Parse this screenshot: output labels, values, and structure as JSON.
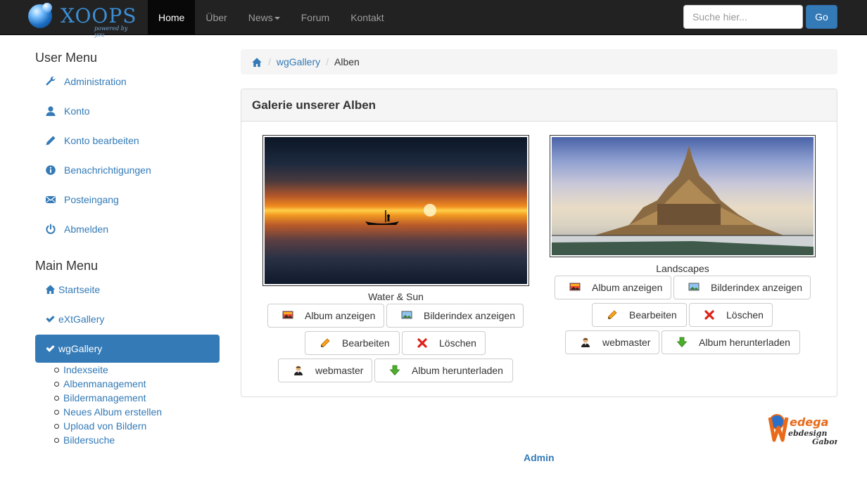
{
  "brand": {
    "name": "XOOPS",
    "tagline": "powered by you"
  },
  "nav": {
    "items": [
      {
        "label": "Home",
        "active": true
      },
      {
        "label": "Über"
      },
      {
        "label": "News",
        "dropdown": true
      },
      {
        "label": "Forum"
      },
      {
        "label": "Kontakt"
      }
    ],
    "search_placeholder": "Suche hier...",
    "search_button": "Go"
  },
  "user_menu": {
    "heading": "User Menu",
    "items": [
      {
        "label": "Administration",
        "icon": "wrench-icon"
      },
      {
        "label": "Konto",
        "icon": "user-icon"
      },
      {
        "label": "Konto bearbeiten",
        "icon": "pencil-icon"
      },
      {
        "label": "Benachrichtigungen",
        "icon": "info-icon"
      },
      {
        "label": "Posteingang",
        "icon": "envelope-icon"
      },
      {
        "label": "Abmelden",
        "icon": "power-icon"
      }
    ]
  },
  "main_menu": {
    "heading": "Main Menu",
    "items": [
      {
        "label": "Startseite",
        "icon": "home-icon"
      },
      {
        "label": "eXtGallery",
        "icon": "check-icon"
      },
      {
        "label": "wgGallery",
        "icon": "check-icon",
        "active": true
      }
    ],
    "submenu": [
      "Indexseite",
      "Albenmanagement",
      "Bildermanagement",
      "Neues Album erstellen",
      "Upload von Bildern",
      "Bildersuche"
    ]
  },
  "breadcrumb": {
    "home_icon": "home-icon",
    "module": "wgGallery",
    "current": "Alben"
  },
  "panel": {
    "title": "Galerie unserer Alben",
    "albums": [
      {
        "name": "Water & Sun",
        "buttons": {
          "show": "Album anzeigen",
          "index": "Bilderindex anzeigen",
          "edit": "Bearbeiten",
          "delete": "Löschen",
          "owner": "webmaster",
          "download": "Album herunterladen"
        }
      },
      {
        "name": "Landscapes",
        "buttons": {
          "show": "Album anzeigen",
          "index": "Bilderindex anzeigen",
          "edit": "Bearbeiten",
          "delete": "Löschen",
          "owner": "webmaster",
          "download": "Album herunterladen"
        }
      }
    ]
  },
  "footer": {
    "logo_text": "Wedega Webdesign Gabor",
    "admin_link": "Admin"
  },
  "colors": {
    "link": "#337ab7",
    "navbar": "#222222",
    "active_menu": "#337ab7"
  }
}
